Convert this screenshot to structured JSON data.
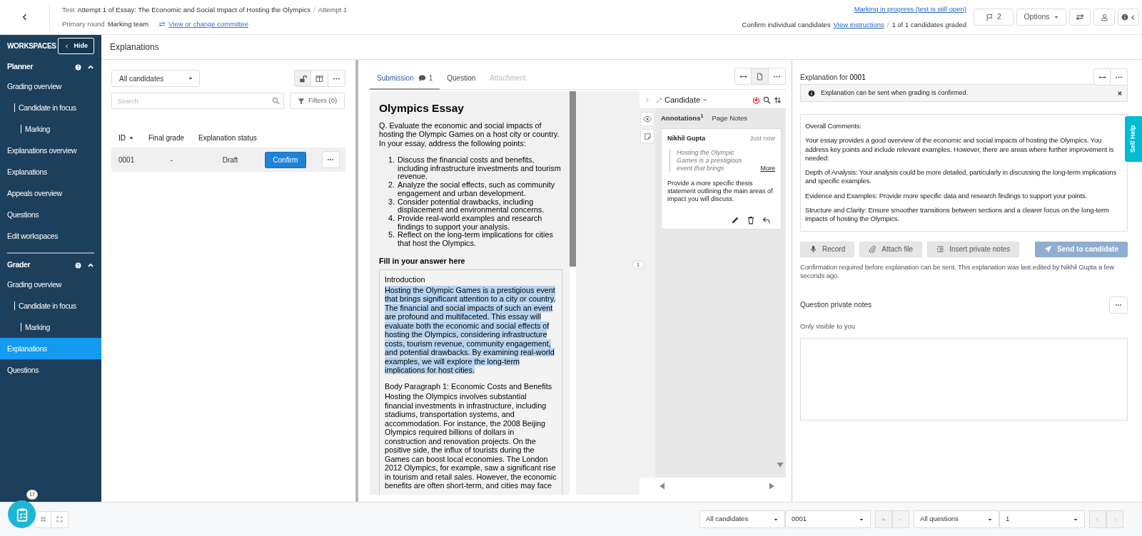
{
  "header": {
    "test_label": "Test",
    "test_title": "Attempt 1 of Essay: The Economic and Social Impact of Hosting the Olympics",
    "title_separator": "/",
    "attempt": "Attempt 1",
    "round_label": "Primary round",
    "team": "Marking team",
    "committee_link": "View or change committee",
    "status_link": "Marking in progress (test is still open)",
    "confirm_text": "Confirm individual candidates",
    "instructions_link": "View instructions",
    "graded_separator": "/",
    "graded": "1 of 1 candidates graded",
    "flag_count": "2",
    "options_button": "Options"
  },
  "sidebar": {
    "title": "WORKSPACES",
    "hide_button": "Hide",
    "sections": [
      {
        "title": "Planner",
        "expanded": true,
        "items": [
          {
            "label": "Grading overview",
            "selected": false,
            "children": [
              {
                "label": "Candidate in focus",
                "selected": false,
                "children": [
                  {
                    "label": "Marking",
                    "selected": false
                  }
                ]
              }
            ]
          },
          {
            "label": "Explanations overview",
            "selected": false
          },
          {
            "label": "Explanations",
            "selected": false
          },
          {
            "label": "Appeals overview",
            "selected": false
          },
          {
            "label": "Questions",
            "selected": false
          },
          {
            "label": "Edit workspaces",
            "selected": false
          }
        ]
      },
      {
        "title": "Grader",
        "expanded": true,
        "items": [
          {
            "label": "Grading overview",
            "selected": false,
            "children": [
              {
                "label": "Candidate in focus",
                "selected": false,
                "children": [
                  {
                    "label": "Marking",
                    "selected": false
                  }
                ]
              }
            ]
          },
          {
            "label": "Explanations",
            "selected": true
          },
          {
            "label": "Questions",
            "selected": false
          }
        ]
      }
    ]
  },
  "page_title": "Explanations",
  "candidates": {
    "filter": "All candidates",
    "toolbar": [
      {
        "kind": "lock",
        "selected": true
      },
      {
        "kind": "columns",
        "selected": false
      },
      {
        "kind": "more",
        "selected": false
      }
    ],
    "search_placeholder": "Search",
    "filters_button": "Filters (0)",
    "columns": [
      {
        "label": "ID",
        "sorted": true
      },
      {
        "label": "Final grade",
        "sorted": false
      },
      {
        "label": "Explanation status",
        "sorted": false
      }
    ],
    "rows": [
      {
        "id": "0001",
        "grade": "-",
        "status": "Draft",
        "action": "Confirm",
        "selected": true
      }
    ]
  },
  "submission": {
    "tabs": [
      {
        "label": "Submission",
        "count": "1",
        "selected": true,
        "disabled": false
      },
      {
        "label": "Question",
        "selected": false,
        "disabled": false
      },
      {
        "label": "Attachment",
        "selected": false,
        "disabled": true
      }
    ],
    "toolbar": [
      {
        "kind": "expand",
        "selected": false
      },
      {
        "kind": "document",
        "selected": true
      },
      {
        "kind": "more",
        "selected": false
      }
    ],
    "document": {
      "title": "Olympics Essay",
      "question": "Q. Evaluate the economic and social impacts of hosting the Olympic Games on a host city or country. In your essay, address the following points:",
      "points": [
        {
          "marker": "1.",
          "text": "Discuss the financial costs and benefits, including infrastructure investments and tourism revenue."
        },
        {
          "marker": "2.",
          "text": "Analyze the social effects, such as community engagement and urban development."
        },
        {
          "marker": "3.",
          "text": "Consider potential drawbacks, including displacement and environmental concerns."
        },
        {
          "marker": "4.",
          "text": "Provide real-world examples and research findings to support your analysis."
        },
        {
          "marker": "5.",
          "text": "Reflect on the long-term implications for cities that host the Olympics."
        }
      ],
      "answer_heading": "Fill in your answer here",
      "answer": [
        {
          "heading": "Introduction",
          "text": "Hosting the Olympic Games is a prestigious event that brings significant attention to a city or country. The financial and social impacts of such an event are profound and multifaceted. This essay will evaluate both the economic and social effects of hosting the Olympics, considering infrastructure costs, tourism revenue, community engagement, and potential drawbacks. By examining real-world examples, we will explore the long-term implications for host cities.",
          "highlighted": true
        },
        {
          "heading": "Body Paragraph 1: Economic Costs and Benefits",
          "text": "Hosting the Olympics involves substantial financial investments in infrastructure, including stadiums, transportation systems, and accommodation. For instance, the 2008 Beijing Olympics required billions of dollars in construction and renovation projects. On the positive side, the influx of tourists during the Games can boost local economies. The London 2012 Olympics, for example, saw a significant rise in tourism and retail sales. However, the economic benefits are often short-term, and cities may face",
          "highlighted": false
        }
      ]
    },
    "page_marker": "1",
    "annotations": {
      "role": "Candidate",
      "tabs": [
        {
          "label": "Annotations",
          "count": "1",
          "selected": true
        },
        {
          "label": "Page Notes",
          "selected": false
        }
      ],
      "items": [
        {
          "author": "Nikhil Gupta",
          "time": "Just now",
          "quote": "Hosting the Olympic Games is a prestigious event that brings",
          "more_link": "More",
          "comment": "Provide a more specific thesis statement outlining the main areas of impact you will discuss."
        }
      ]
    }
  },
  "explanation": {
    "title_label": "Explanation for",
    "candidate": "0001",
    "toolbar": [
      {
        "kind": "expand",
        "selected": false
      },
      {
        "kind": "more",
        "selected": false
      }
    ],
    "alert": "Explanation can be sent when grading is confirmed.",
    "paragraphs": [
      "Overall Comments:",
      "Your essay provides a good overview of the economic and social impacts of hosting the Olympics. You address key points and include relevant examples. However, there are areas where further improvement is needed:",
      "Depth of Analysis: Your analysis could be more detailed, particularly in discussing the long-term implications and specific examples.",
      "Evidence and Examples: Provide more specific data and research findings to support your points.",
      "Structure and Clarity: Ensure smoother transitions between sections and a clearer focus on the long-term impacts of hosting the Olympics."
    ],
    "actions": [
      {
        "kind": "record",
        "label": "Record",
        "disabled": false
      },
      {
        "kind": "attach",
        "label": "Attach file",
        "disabled": false
      },
      {
        "kind": "notes",
        "label": "Insert private notes",
        "disabled": false
      }
    ],
    "send_button": {
      "label": "Send to candidate",
      "disabled": true
    },
    "note": "Confirmation required before explanation can be sent. This explanation was last edited by Nikhil Gupta a few seconds ago.",
    "private_notes": {
      "title": "Question private notes",
      "hint": "Only visible to you"
    }
  },
  "self_help": "Self Help",
  "footer": {
    "badge": "17",
    "controls": [
      {
        "kind": "select",
        "value": "All candidates"
      },
      {
        "kind": "select",
        "value": "0001"
      },
      {
        "kind": "vertical_pager",
        "disabled": true
      },
      {
        "kind": "select",
        "value": "All questions"
      },
      {
        "kind": "select",
        "value": "1"
      },
      {
        "kind": "horizontal_pager",
        "disabled": true
      }
    ]
  }
}
